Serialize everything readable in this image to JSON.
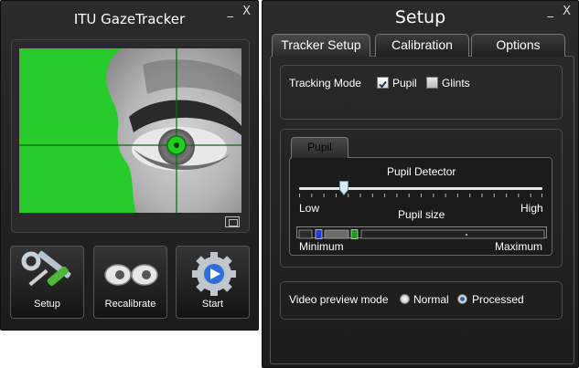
{
  "gaze_window": {
    "title": "ITU GazeTracker",
    "minimize": "_",
    "close": "X",
    "buttons": {
      "setup": "Setup",
      "recalibrate": "Recalibrate",
      "start": "Start"
    }
  },
  "setup_window": {
    "title": "Setup",
    "minimize": "_",
    "close": "X",
    "tabs": [
      "Tracker Setup",
      "Calibration",
      "Options"
    ],
    "tracking_mode": {
      "label": "Tracking Mode",
      "pupil_label": "Pupil",
      "pupil_checked": true,
      "glints_label": "Glints",
      "glints_checked": false
    },
    "pupil_tab": "Pupil",
    "pupil_detector": {
      "title": "Pupil Detector",
      "low": "Low",
      "high": "High",
      "value_fraction": 0.19
    },
    "pupil_size": {
      "title": "Pupil size",
      "minimum": "Minimum",
      "maximum": "Maximum"
    },
    "video_preview": {
      "label": "Video preview mode",
      "normal": "Normal",
      "processed": "Processed",
      "selected": "Processed"
    }
  },
  "colors": {
    "tracking_green": "#22cc22",
    "crosshair": "#0a7a0a",
    "window_bg": "#1f1f1f",
    "accent_blue": "#3a62a8"
  }
}
